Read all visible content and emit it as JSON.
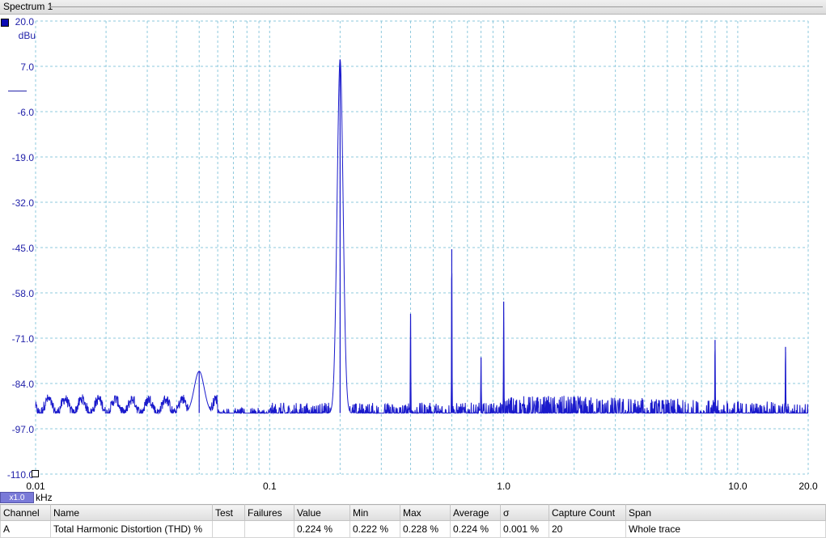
{
  "window": {
    "tab_title": "Spectrum 1"
  },
  "chart_data": {
    "type": "line",
    "title": "",
    "xlabel": "kHz",
    "ylabel": "dBu",
    "x_scale": "log",
    "xlim": [
      0.01,
      20.0
    ],
    "ylim": [
      -110.0,
      20.0
    ],
    "x_tick_labels": [
      "0.01",
      "0.1",
      "1.0",
      "10.0",
      "20.0"
    ],
    "x_ticks": [
      0.01,
      0.1,
      1.0,
      10.0,
      20.0
    ],
    "y_ticks": [
      20.0,
      7.0,
      -6.0,
      -19.0,
      -32.0,
      -45.0,
      -58.0,
      -71.0,
      -84.0,
      -97.0,
      -110.0
    ],
    "y_tick_labels": [
      "20.0",
      "7.0",
      "-6.0",
      "-19.0",
      "-32.0",
      "-45.0",
      "-58.0",
      "-71.0",
      "-84.0",
      "-97.0",
      "-110.0"
    ],
    "grid": true,
    "series": [
      {
        "color": "#1a1acc",
        "noise_floor_db": -92.5,
        "peaks": [
          {
            "x": 0.05,
            "y": -80.5
          },
          {
            "x": 0.2,
            "y": 9.0
          },
          {
            "x": 0.4,
            "y": -64.0
          },
          {
            "x": 0.6,
            "y": -45.5
          },
          {
            "x": 0.8,
            "y": -76.5
          },
          {
            "x": 1.0,
            "y": -60.5
          },
          {
            "x": 8.0,
            "y": -71.5
          },
          {
            "x": 16.0,
            "y": -73.5
          }
        ]
      }
    ]
  },
  "zoom_label": "x1.0",
  "results": {
    "headers": [
      "Channel",
      "Name",
      "Test",
      "Failures",
      "Value",
      "Min",
      "Max",
      "Average",
      "σ",
      "Capture Count",
      "Span"
    ],
    "rows": [
      [
        "A",
        "Total Harmonic Distortion (THD) %",
        "",
        "",
        "0.224 %",
        "0.222 %",
        "0.228 %",
        "0.224 %",
        "0.001 %",
        "20",
        "Whole trace"
      ]
    ]
  }
}
